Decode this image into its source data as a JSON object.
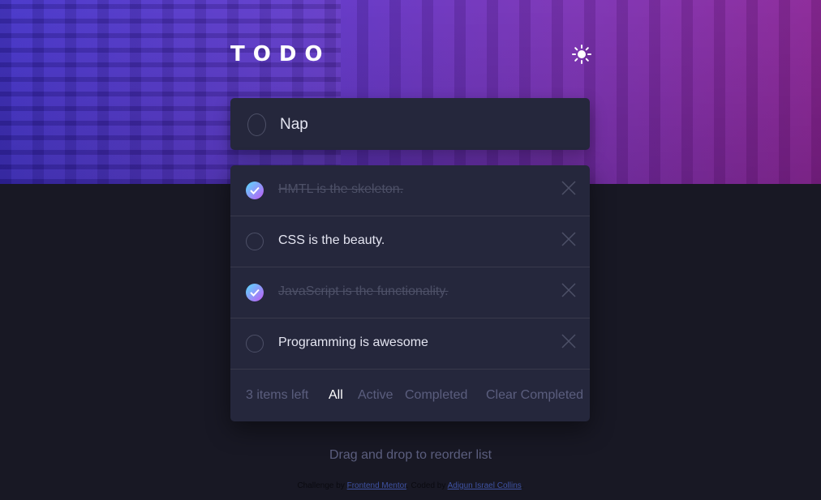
{
  "header": {
    "title": "TODO",
    "theme_icon": "sun-icon"
  },
  "new_todo": {
    "value": "Nap"
  },
  "todos": [
    {
      "text": "HMTL is the skeleton.",
      "completed": true
    },
    {
      "text": "CSS is the beauty.",
      "completed": false
    },
    {
      "text": "JavaScript is the functionality.",
      "completed": true
    },
    {
      "text": "Programming is awesome",
      "completed": false
    }
  ],
  "footer": {
    "items_left": "3 items left",
    "filters": {
      "all": "All",
      "active": "Active",
      "completed": "Completed"
    },
    "active_filter": "All",
    "clear_label": "Clear Completed"
  },
  "hint": "Drag and drop to reorder list",
  "attribution": {
    "prefix": "Challenge by",
    "link1": "Frontend Mentor",
    "middle": ". Coded by",
    "link2": "Adigun Israel Collins",
    "suffix": "."
  },
  "colors": {
    "accent_gradient_start": "#57ddff",
    "accent_gradient_end": "#c058f3",
    "background": "#181824",
    "card": "#25273c"
  }
}
